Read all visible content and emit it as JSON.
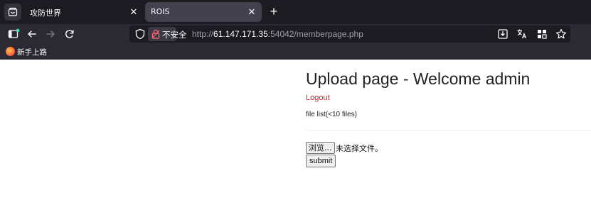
{
  "tabs": [
    {
      "title": "攻防世界",
      "active": false
    },
    {
      "title": "ROIS",
      "active": true
    }
  ],
  "tab_close_glyph": "✕",
  "new_tab_glyph": "+",
  "urlbar": {
    "security_label": "不安全",
    "url_scheme": "http://",
    "url_host": "61.147.171.35",
    "url_rest": ":54042/memberpage.php"
  },
  "bookmarks": [
    {
      "label": "新手上路",
      "icon": "firefox-icon"
    }
  ],
  "page": {
    "heading": "Upload page - Welcome admin",
    "logout_label": "Logout",
    "file_list_label": "file list(<10 files)",
    "browse_button_label": "浏览...",
    "no_file_text": "未选择文件。",
    "submit_label": "submit"
  },
  "colors": {
    "chrome_bg": "#2b2a33",
    "tabbar_bg": "#1c1b22",
    "logout_link": "#e0182a",
    "notsecure_icon": "#ff6a75"
  }
}
